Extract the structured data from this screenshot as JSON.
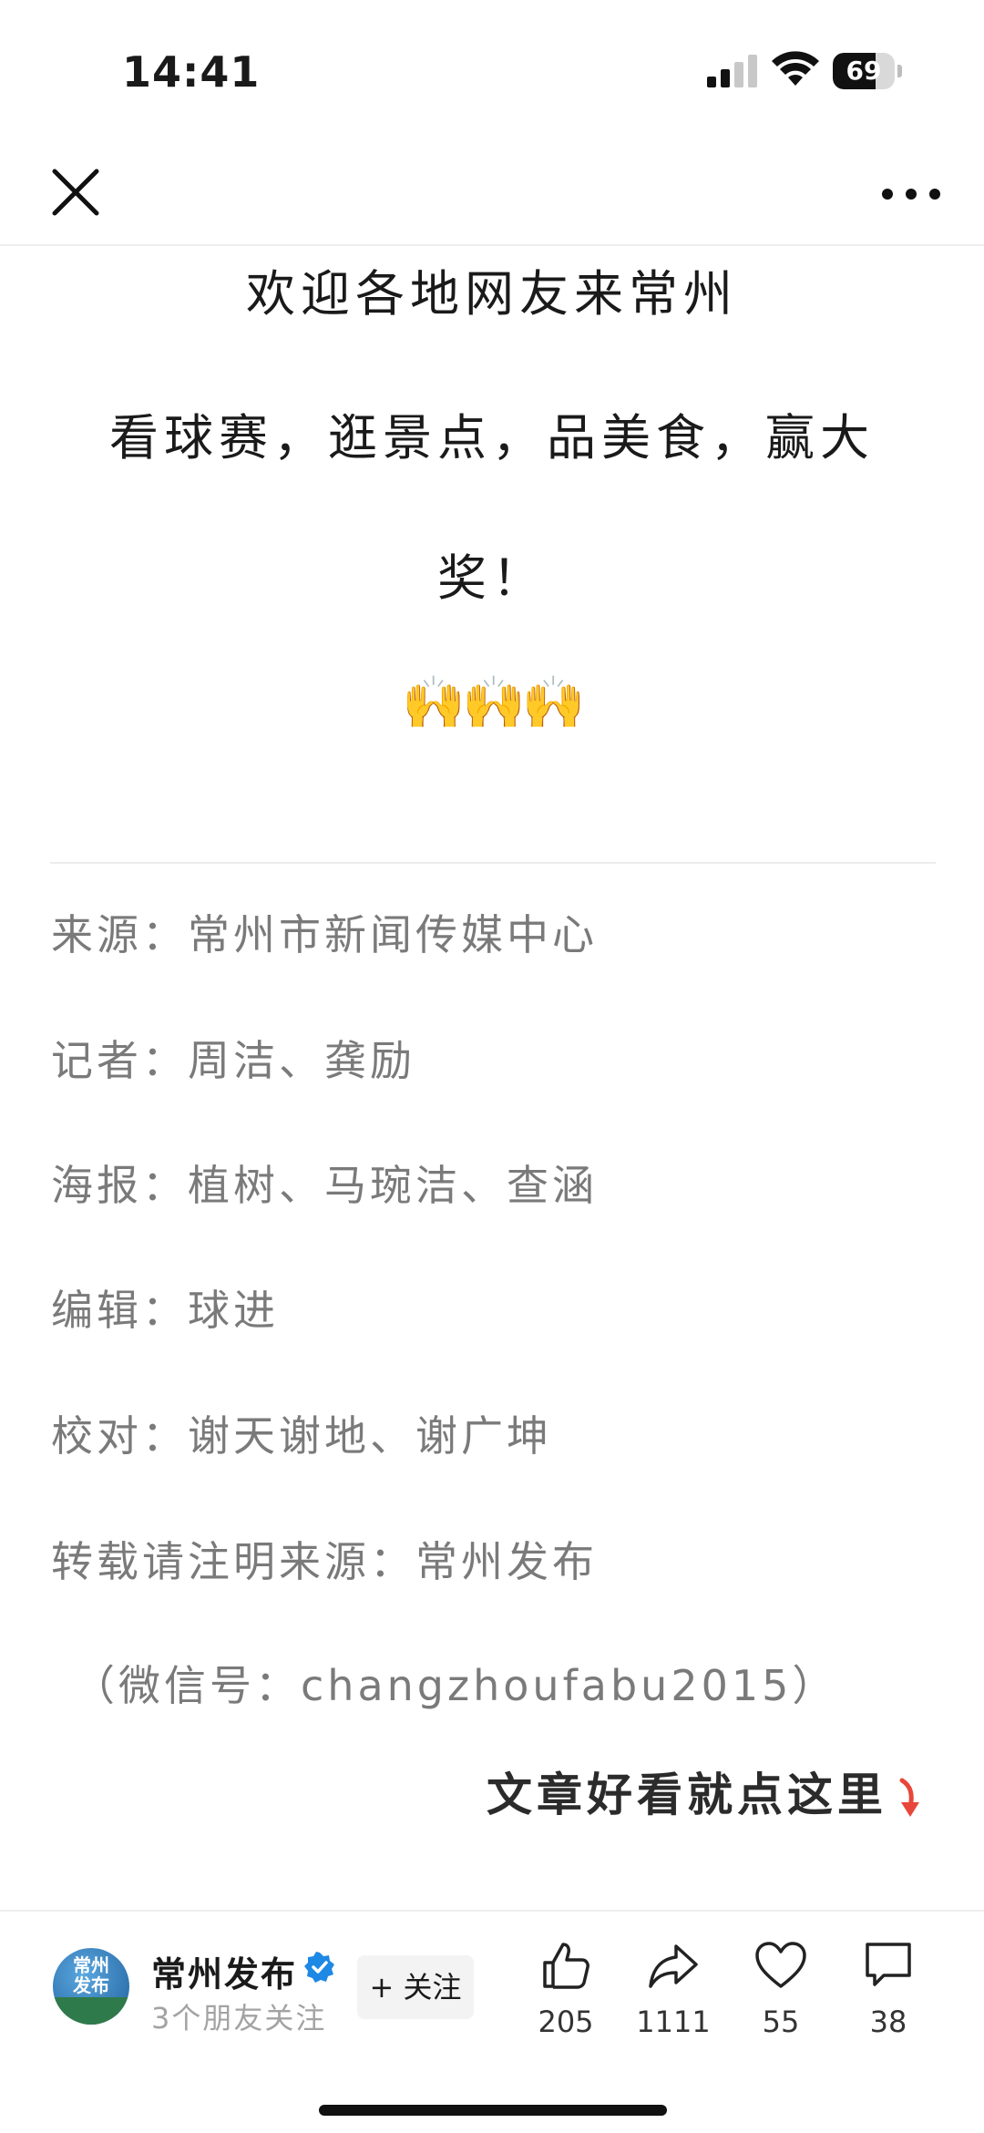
{
  "status_bar": {
    "time": "14:41",
    "battery": "69",
    "battery_level": 0.69
  },
  "article": {
    "headline_lines": [
      "欢迎各地网友来常州",
      "看球赛，逛景点，品美食，赢大",
      "奖！"
    ],
    "emoji": "🙌🙌🙌",
    "credits": [
      "来源：常州市新闻传媒中心",
      "记者：周洁、龚励",
      "海报：植树、马琬洁、查涵",
      "编辑：球进",
      "校对：谢天谢地、谢广坤",
      "转载请注明来源：常州发布",
      "（微信号：changzhoufabu2015）"
    ],
    "cta": "文章好看就点这里"
  },
  "account": {
    "avatar_text": "常州发布",
    "name": "常州发布",
    "friends_following": "3个朋友关注",
    "follow_label": "+ 关注"
  },
  "actions": {
    "likes": "205",
    "shares": "1111",
    "favorites": "55",
    "comments": "38"
  },
  "colors": {
    "accent_red": "#e8463a",
    "verified_blue": "#1e88e5",
    "muted_text": "#7a7a7a"
  },
  "icons": {
    "close": "close-icon",
    "more": "more-icon",
    "like": "thumbs-up-icon",
    "share": "share-arrow-icon",
    "favorite": "heart-icon",
    "comment": "comment-bubble-icon",
    "verified": "verified-badge-icon"
  }
}
